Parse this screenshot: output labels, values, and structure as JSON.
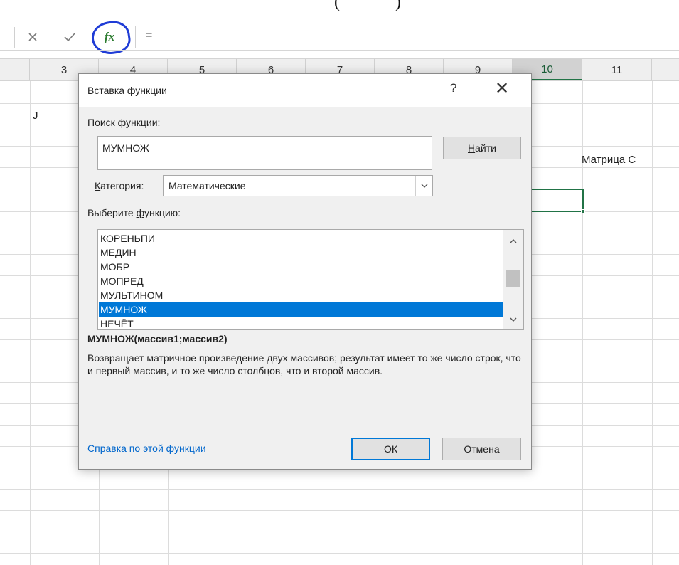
{
  "top_fragment": "(             )",
  "formula_bar": {
    "cancel_icon": "close-icon",
    "enter_icon": "check-icon",
    "fx_label": "fx",
    "content": "="
  },
  "columns": [
    "3",
    "4",
    "5",
    "6",
    "7",
    "8",
    "9",
    "10",
    "11"
  ],
  "selected_column": "10",
  "cells": {
    "j_label": "J",
    "matrix_c": "Матрица С"
  },
  "dialog": {
    "title": "Вставка функции",
    "help_glyph": "?",
    "close_glyph": "✕",
    "search_label_u": "П",
    "search_label_rest": "оиск функции:",
    "search_value": "МУМНОЖ",
    "find_button_u": "Н",
    "find_button_rest": "айти",
    "category_label_u": "К",
    "category_label_rest": "атегория:",
    "category_value": "Математические",
    "select_label_pre": "Выберите ",
    "select_label_u": "ф",
    "select_label_rest": "ункцию:",
    "functions": [
      "КОРЕНЬПИ",
      "МЕДИН",
      "МОБР",
      "МОПРЕД",
      "МУЛЬТИНОМ",
      "МУМНОЖ",
      "НЕЧЁТ"
    ],
    "selected_function": "МУМНОЖ",
    "signature": "МУМНОЖ(массив1;массив2)",
    "description": "Возвращает матричное произведение двух массивов; результат имеет то же число строк, что и первый массив, и то же число столбцов, что и второй массив.",
    "help_link": "Справка по этой функции",
    "ok_label": "ОК",
    "cancel_label": "Отмена"
  }
}
